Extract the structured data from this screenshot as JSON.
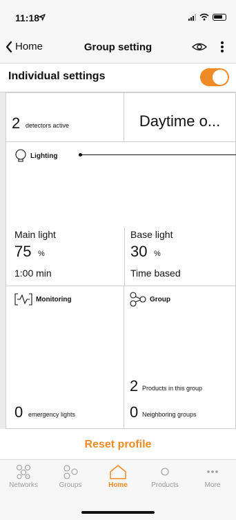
{
  "status": {
    "time": "11:18"
  },
  "nav": {
    "back_label": "Home",
    "title": "Group setting"
  },
  "individual": {
    "label": "Individual settings",
    "toggle_on": true
  },
  "detectors": {
    "count": "2",
    "label": "detectors active"
  },
  "daytime": {
    "label": "Daytime o..."
  },
  "lighting": {
    "title": "Lighting",
    "main": {
      "label": "Main light",
      "value": "75",
      "unit": "%",
      "duration": "1:00 min"
    },
    "base": {
      "label": "Base light",
      "value": "30",
      "unit": "%",
      "mode": "Time based"
    }
  },
  "monitoring": {
    "title": "Monitoring",
    "count": "0",
    "label": "emergency lights"
  },
  "group": {
    "title": "Group",
    "products_count": "2",
    "products_label": "Products in this group",
    "neighbors_count": "0",
    "neighbors_label": "Neighboring groups"
  },
  "reset_label": "Reset profile",
  "tabs": [
    {
      "label": "Networks",
      "icon": "networks-icon"
    },
    {
      "label": "Groups",
      "icon": "groups-icon"
    },
    {
      "label": "Home",
      "icon": "home-icon",
      "active": true
    },
    {
      "label": "Products",
      "icon": "products-icon"
    },
    {
      "label": "More",
      "icon": "more-dots-icon"
    }
  ],
  "colors": {
    "accent": "#f08a24",
    "inactive": "#9a9a9a",
    "bar": "#f7f7f7"
  }
}
